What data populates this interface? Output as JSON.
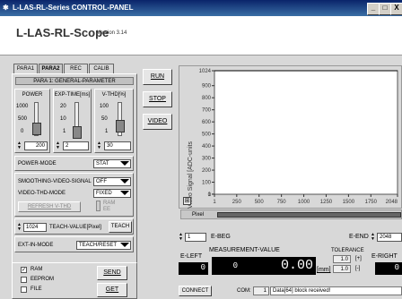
{
  "window": {
    "title": "L-LAS-RL-Series CONTROL-PANEL",
    "min": "_",
    "max": "□",
    "close": "X"
  },
  "header": {
    "name": "L-LAS-RL-Scope",
    "version": "Version 3.14"
  },
  "tabs": [
    "PARA1",
    "PARA2",
    "REC",
    "CALIB"
  ],
  "panel_title": "PARA 1: GENERAL-PARAMETER",
  "power": {
    "label": "POWER",
    "ticks": [
      "1000",
      "500",
      "0"
    ],
    "value": "200",
    "level": 0.2
  },
  "exp_time": {
    "label": "EXP-TIME[ms]",
    "ticks": [
      "20",
      "10",
      "1"
    ],
    "value": "2",
    "level": 0.1
  },
  "vthd": {
    "label": "V-THD[%]",
    "ticks": [
      "100",
      "50",
      "1"
    ],
    "value": "30",
    "level": 0.3
  },
  "power_mode": {
    "label": "POWER-MODE",
    "value": "STAT"
  },
  "smoothing": {
    "label": "SMOOTHING-VIDEO-SIGNAL",
    "value": "OFF"
  },
  "video_thd_mode": {
    "label": "VIDEO-THD-MODE",
    "value": "FIXED"
  },
  "refresh_btn": "REFRESH V-THD",
  "ram_ee": {
    "ram": "RAM",
    "ee": "EE"
  },
  "teach": {
    "value": "1024",
    "label": "TEACH-VALUE[Pixel]",
    "button": "TEACH"
  },
  "ext_in_mode": {
    "label": "EXT-IN-MODE",
    "value": "TEACH/RESET"
  },
  "buttons": {
    "run": "RUN",
    "stop": "STOP",
    "video": "VIDEO",
    "send": "SEND",
    "get": "GET",
    "connect": "CONNECT"
  },
  "memory": [
    {
      "label": "RAM",
      "checked": true
    },
    {
      "label": "EEPROM",
      "checked": false
    },
    {
      "label": "FILE",
      "checked": false
    }
  ],
  "chart_data": {
    "type": "line",
    "ylabel": "Video Signal [ADC-units",
    "xlabel": "Pixel",
    "xlim": [
      1,
      2048
    ],
    "ylim": [
      0,
      1024
    ],
    "x_ticks": [
      "1",
      "250",
      "500",
      "750",
      "1000",
      "1250",
      "1500",
      "1750",
      "2048"
    ],
    "y_ticks": [
      "1024",
      "900",
      "800",
      "700",
      "600",
      "500",
      "400",
      "300",
      "200",
      "100",
      "1",
      "0"
    ],
    "series": [
      {
        "x": [
          1,
          2048
        ],
        "y": [
          1024,
          1024
        ]
      }
    ]
  },
  "scrollbar_label": "Pixel",
  "ebeg": {
    "value": "1",
    "label": "E-BEG"
  },
  "eend": {
    "label": "E-END",
    "value": "2048"
  },
  "measurement": {
    "title": "MEASUREMENT-VALUE",
    "left_label": "E-LEFT",
    "left_value": "0",
    "mid_value": "0",
    "value": "0.00",
    "unit": "[mm]",
    "tolerance_label": "TOLERANCE",
    "tol_plus": "1.0",
    "tol_plus_sign": "[+]",
    "tol_minus": "1.0",
    "tol_minus_sign": "[-]",
    "right_label": "E-RIGHT",
    "right_value": "0"
  },
  "status": {
    "com_label": "COM:",
    "com_value": "1",
    "message": "Data[64] block received!"
  }
}
